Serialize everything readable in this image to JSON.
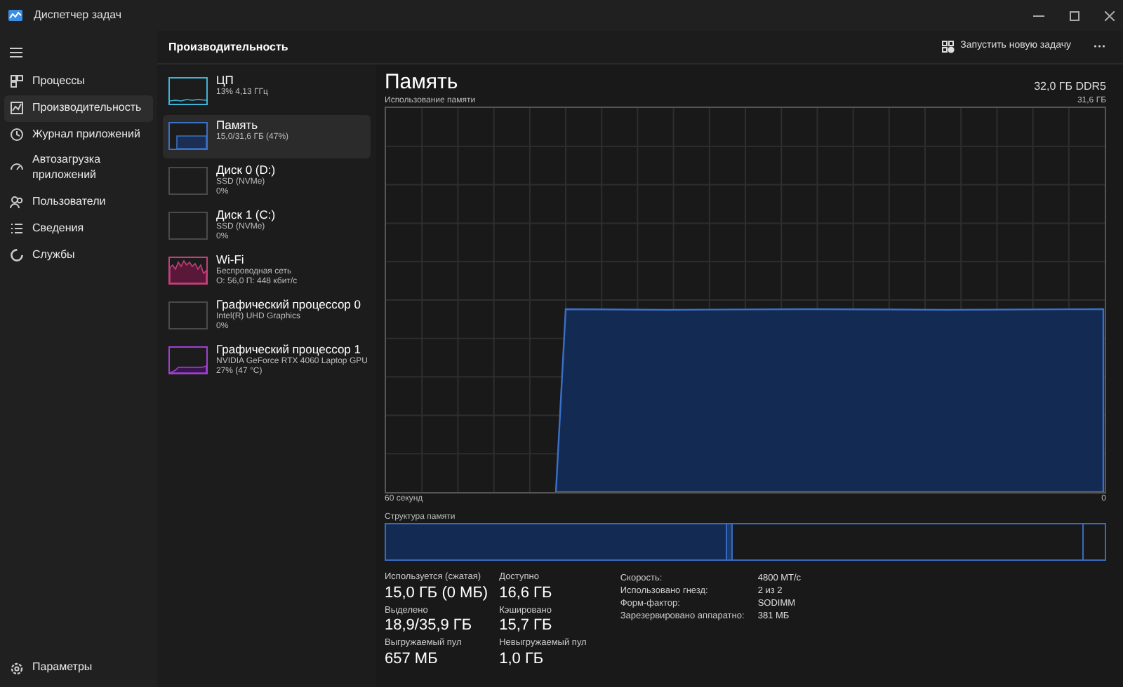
{
  "window": {
    "title": "Диспетчер задач"
  },
  "nav": {
    "items": [
      {
        "label": "Процессы",
        "selected": false
      },
      {
        "label": "Производительность",
        "selected": true
      },
      {
        "label": "Журнал приложений",
        "selected": false
      },
      {
        "label": "Автозагрузка приложений",
        "selected": false
      },
      {
        "label": "Пользователи",
        "selected": false
      },
      {
        "label": "Сведения",
        "selected": false
      },
      {
        "label": "Службы",
        "selected": false
      }
    ],
    "settings": "Параметры"
  },
  "header": {
    "title": "Производительность",
    "run_task": "Запустить новую задачу",
    "more": "···"
  },
  "devices": [
    {
      "kind": "cpu",
      "name": "ЦП",
      "lines": [
        "13% 4,13 ГГц"
      ],
      "color": "#3fb4d6",
      "selected": false
    },
    {
      "kind": "memory",
      "name": "Память",
      "lines": [
        "15,0/31,6 ГБ (47%)"
      ],
      "color": "#3a70c8",
      "selected": true
    },
    {
      "kind": "disk",
      "name": "Диск 0 (D:)",
      "lines": [
        "SSD (NVMe)",
        "0%"
      ],
      "color": "#4a4a4a",
      "selected": false
    },
    {
      "kind": "disk",
      "name": "Диск 1 (C:)",
      "lines": [
        "SSD (NVMe)",
        "0%"
      ],
      "color": "#4a4a4a",
      "selected": false
    },
    {
      "kind": "wifi",
      "name": "Wi-Fi",
      "lines": [
        "Беспроводная сеть",
        "О: 56,0 П: 448 кбит/с"
      ],
      "color": "#c2407a",
      "selected": false
    },
    {
      "kind": "gpu_idle",
      "name": "Графический процессор 0",
      "lines": [
        "Intel(R) UHD Graphics",
        "0%"
      ],
      "color": "#4a4a4a",
      "selected": false
    },
    {
      "kind": "gpu",
      "name": "Графический процессор 1",
      "lines": [
        "NVIDIA GeForce RTX 4060 Laptop GPU",
        "27% (47 °C)"
      ],
      "color": "#a040d0",
      "selected": false
    }
  ],
  "detail": {
    "title": "Память",
    "spec": "32,0 ГБ DDR5",
    "usage_graph": {
      "title": "Использование памяти",
      "max_label": "31,6 ГБ",
      "start_label": "60 секунд",
      "end_label": "0"
    },
    "composition": {
      "label": "Структура памяти"
    },
    "stats": [
      [
        {
          "label": "Используется (сжатая)",
          "value": "15,0 ГБ (0 МБ)"
        },
        {
          "label": "Доступно",
          "value": "16,6 ГБ"
        }
      ],
      [
        {
          "label": "Выделено",
          "value": "18,9/35,9 ГБ"
        },
        {
          "label": "Кэшировано",
          "value": "15,7 ГБ"
        }
      ],
      [
        {
          "label": "Выгружаемый пул",
          "value": "657 МБ"
        },
        {
          "label": "Невыгружаемый пул",
          "value": "1,0 ГБ"
        }
      ]
    ],
    "properties": [
      {
        "key": "Скорость:",
        "value": "4800 МТ/с"
      },
      {
        "key": "Использовано гнезд:",
        "value": "2 из 2"
      },
      {
        "key": "Форм-фактор:",
        "value": "SODIMM"
      },
      {
        "key": "Зарезервировано аппаратно:",
        "value": "381 МБ"
      }
    ]
  }
}
